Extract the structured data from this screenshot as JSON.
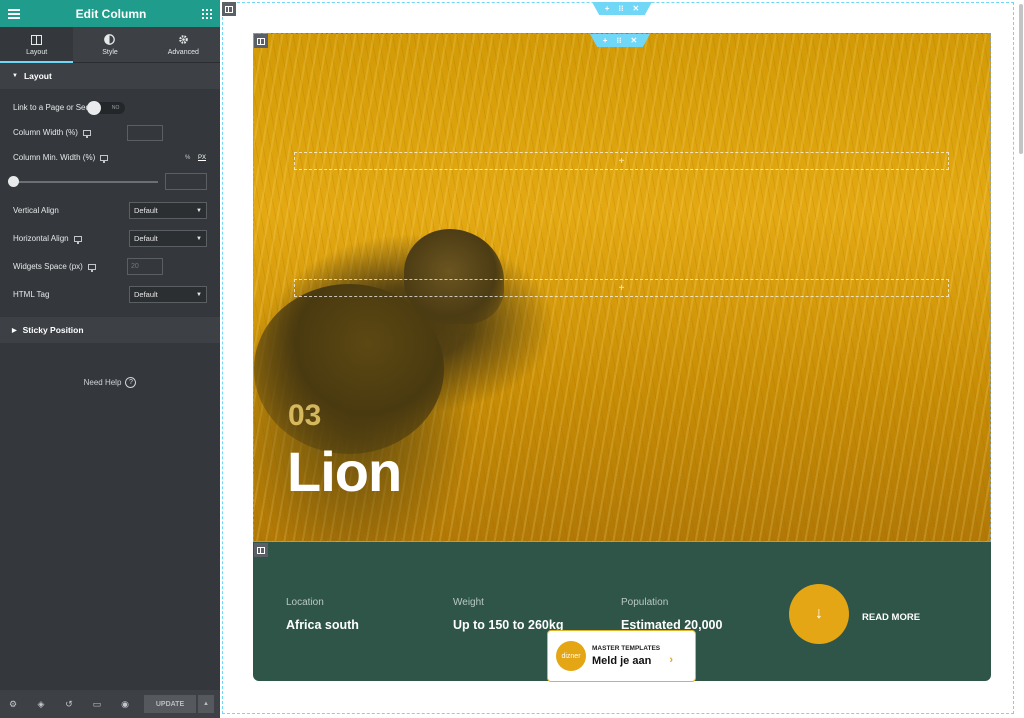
{
  "panel": {
    "title": "Edit Column",
    "tabs": [
      {
        "label": "Layout",
        "icon": "columns-icon",
        "active": true
      },
      {
        "label": "Style",
        "icon": "half-circle-icon",
        "active": false
      },
      {
        "label": "Advanced",
        "icon": "gear-icon",
        "active": false
      }
    ],
    "layout_section": "Layout",
    "fields": {
      "link_label": "Link to a Page or Section",
      "link_toggle": "NO",
      "column_width_label": "Column Width (%)",
      "column_min_width_label": "Column Min. Width (%)",
      "units_percent": "%",
      "units_px": "PX",
      "min_width_slider_value": 0,
      "vertical_align_label": "Vertical Align",
      "vertical_align_value": "Default",
      "horizontal_align_label": "Horizontal Align",
      "horizontal_align_value": "Default",
      "widgets_space_label": "Widgets Space (px)",
      "widgets_space_placeholder": "20",
      "html_tag_label": "HTML Tag",
      "html_tag_value": "Default"
    },
    "sticky_section": "Sticky Position",
    "need_help": "Need Help",
    "footer": {
      "icons": [
        "gear-icon",
        "layers-icon",
        "history-icon",
        "responsive-icon",
        "eye-icon"
      ],
      "update_label": "UPDATE"
    }
  },
  "hero": {
    "number": "03",
    "title": "Lion"
  },
  "info": {
    "stats": [
      {
        "key": "Location",
        "value": "Africa south"
      },
      {
        "key": "Weight",
        "value": "Up to 150 to 260kg"
      },
      {
        "key": "Population",
        "value": "Estimated 20,000"
      }
    ],
    "read_more": "READ MORE"
  },
  "promo": {
    "logo_text": "dizner",
    "kicker": "MASTER TEMPLATES",
    "title": "Meld je aan"
  },
  "colors": {
    "panel_header": "#1f9c8c",
    "panel_bg": "#34383c",
    "accent_blue": "#71d7f7",
    "info_green": "#2e5548",
    "gold": "#e4a614"
  }
}
